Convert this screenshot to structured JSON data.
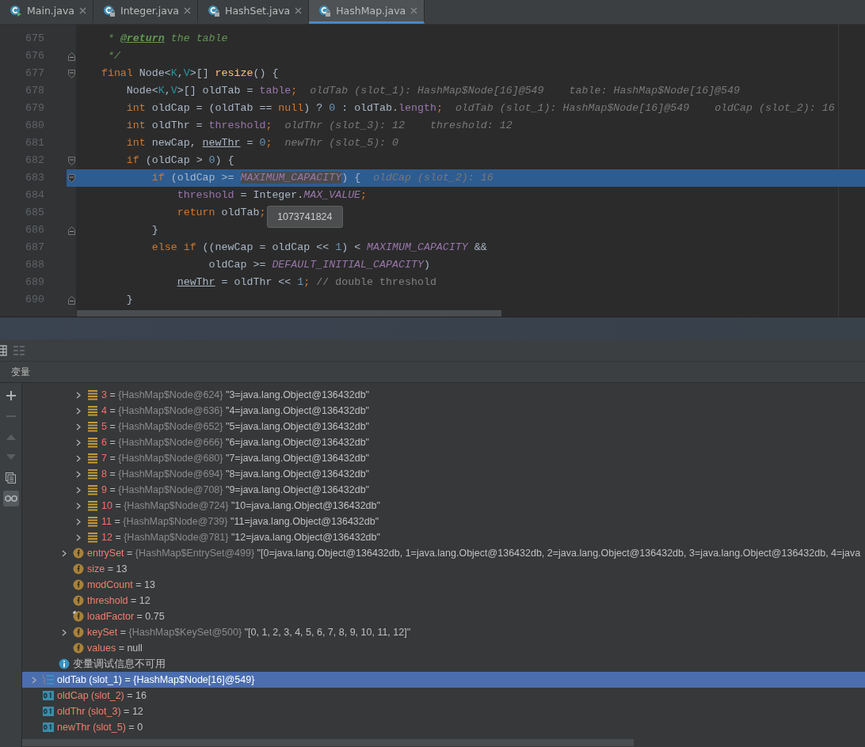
{
  "tabs": [
    {
      "label": "Main.java",
      "locked": false,
      "selected": false
    },
    {
      "label": "Integer.java",
      "locked": true,
      "selected": false
    },
    {
      "label": "HashSet.java",
      "locked": true,
      "selected": false
    },
    {
      "label": "HashMap.java",
      "locked": true,
      "selected": true
    }
  ],
  "editor": {
    "lines": [
      {
        "number": "675",
        "current": false,
        "tokens": [
          {
            "kind": "doc",
            "text": "     * "
          },
          {
            "kind": "doctag",
            "text": "@return"
          },
          {
            "kind": "doc",
            "text": " the table"
          }
        ]
      },
      {
        "number": "676",
        "fold_end": true,
        "current": false,
        "tokens": [
          {
            "kind": "doc",
            "text": "     */"
          }
        ]
      },
      {
        "number": "677",
        "fold_start": true,
        "current": false,
        "tokens": [
          {
            "kind": "kw",
            "text": "    final "
          },
          {
            "kind": "plain",
            "text": "Node<"
          },
          {
            "kind": "tp",
            "text": "K"
          },
          {
            "kind": "plain",
            "text": ","
          },
          {
            "kind": "tp",
            "text": "V"
          },
          {
            "kind": "plain",
            "text": ">[] "
          },
          {
            "kind": "fn",
            "text": "resize"
          },
          {
            "kind": "plain",
            "text": "() {"
          }
        ]
      },
      {
        "number": "678",
        "current": false,
        "tokens": [
          {
            "kind": "plain",
            "text": "        Node<"
          },
          {
            "kind": "tp",
            "text": "K"
          },
          {
            "kind": "plain",
            "text": ","
          },
          {
            "kind": "tp",
            "text": "V"
          },
          {
            "kind": "plain",
            "text": ">[] oldTab = "
          },
          {
            "kind": "field",
            "text": "table"
          },
          {
            "kind": "kw",
            "text": ";"
          }
        ],
        "hints": [
          "oldTab (slot_1): HashMap$Node[16]@549",
          "table: HashMap$Node[16]@549"
        ]
      },
      {
        "number": "679",
        "current": false,
        "tokens": [
          {
            "kind": "kw",
            "text": "        int "
          },
          {
            "kind": "plain",
            "text": "oldCap = (oldTab == "
          },
          {
            "kind": "kw",
            "text": "null"
          },
          {
            "kind": "plain",
            "text": ") ? "
          },
          {
            "kind": "num",
            "text": "0"
          },
          {
            "kind": "plain",
            "text": " : oldTab."
          },
          {
            "kind": "field",
            "text": "length"
          },
          {
            "kind": "kw",
            "text": ";"
          }
        ],
        "hints": [
          "oldTab (slot_1): HashMap$Node[16]@549",
          "oldCap (slot_2): 16"
        ]
      },
      {
        "number": "680",
        "current": false,
        "tokens": [
          {
            "kind": "kw",
            "text": "        int "
          },
          {
            "kind": "plain",
            "text": "oldThr = "
          },
          {
            "kind": "field",
            "text": "threshold"
          },
          {
            "kind": "kw",
            "text": ";"
          }
        ],
        "hints": [
          "oldThr (slot_3): 12",
          "threshold: 12"
        ]
      },
      {
        "number": "681",
        "current": false,
        "tokens": [
          {
            "kind": "kw",
            "text": "        int "
          },
          {
            "kind": "plain",
            "text": "newCap, "
          },
          {
            "kind": "underline",
            "text": "newThr"
          },
          {
            "kind": "plain",
            "text": " = "
          },
          {
            "kind": "num",
            "text": "0"
          },
          {
            "kind": "kw",
            "text": ";"
          }
        ],
        "hints": [
          "newThr (slot_5): 0"
        ]
      },
      {
        "number": "682",
        "fold_start": true,
        "current": false,
        "tokens": [
          {
            "kind": "kw",
            "text": "        if "
          },
          {
            "kind": "plain",
            "text": "(oldCap > "
          },
          {
            "kind": "num",
            "text": "0"
          },
          {
            "kind": "plain",
            "text": ") {"
          }
        ]
      },
      {
        "number": "683",
        "fold_start": true,
        "current": true,
        "tokens": [
          {
            "kind": "kw",
            "text": "            if "
          },
          {
            "kind": "plain",
            "text": "(oldCap >= "
          },
          {
            "kind": "hovered",
            "text": "MAXIMUM_CAPACITY"
          },
          {
            "kind": "plain",
            "text": ") {"
          }
        ],
        "hints": [
          "oldCap (slot_2): 16"
        ]
      },
      {
        "number": "684",
        "current": false,
        "tokens": [
          {
            "kind": "field",
            "text": "                threshold"
          },
          {
            "kind": "plain",
            "text": " = Integer."
          },
          {
            "kind": "const",
            "text": "MAX_VALUE"
          },
          {
            "kind": "kw",
            "text": ";"
          }
        ]
      },
      {
        "number": "685",
        "current": false,
        "tokens": [
          {
            "kind": "kw",
            "text": "                return "
          },
          {
            "kind": "plain",
            "text": "oldTab"
          },
          {
            "kind": "kw",
            "text": ";"
          }
        ]
      },
      {
        "number": "686",
        "fold_end": true,
        "current": false,
        "tokens": [
          {
            "kind": "plain",
            "text": "            }"
          }
        ]
      },
      {
        "number": "687",
        "current": false,
        "tokens": [
          {
            "kind": "kw",
            "text": "            else if "
          },
          {
            "kind": "plain",
            "text": "((newCap = oldCap << "
          },
          {
            "kind": "num",
            "text": "1"
          },
          {
            "kind": "plain",
            "text": ") < "
          },
          {
            "kind": "const",
            "text": "MAXIMUM_CAPACITY"
          },
          {
            "kind": "plain",
            "text": " &&"
          }
        ]
      },
      {
        "number": "688",
        "current": false,
        "tokens": [
          {
            "kind": "plain",
            "text": "                     oldCap >= "
          },
          {
            "kind": "const",
            "text": "DEFAULT_INITIAL_CAPACITY"
          },
          {
            "kind": "plain",
            "text": ")"
          }
        ]
      },
      {
        "number": "689",
        "current": false,
        "tokens": [
          {
            "kind": "underline",
            "text": "                newThr"
          },
          {
            "kind": "plain",
            "text": " = oldThr << "
          },
          {
            "kind": "num",
            "text": "1"
          },
          {
            "kind": "kw",
            "text": "; "
          },
          {
            "kind": "comment",
            "text": "// double threshold"
          }
        ]
      },
      {
        "number": "690",
        "fold_end": true,
        "current": false,
        "tokens": [
          {
            "kind": "plain",
            "text": "        }"
          }
        ]
      }
    ],
    "tooltip": "1073741824"
  },
  "panel": {
    "title": "变量",
    "side_toolbar": [
      {
        "kind": "add",
        "disabled": false,
        "on": false
      },
      {
        "kind": "remove",
        "disabled": true,
        "on": false
      },
      {
        "kind": "up",
        "disabled": true,
        "on": false
      },
      {
        "kind": "down",
        "disabled": true,
        "on": false
      },
      {
        "kind": "copy",
        "disabled": false,
        "on": false
      },
      {
        "kind": "watch",
        "disabled": false,
        "on": true
      }
    ],
    "variables": [
      {
        "kind": "entry",
        "expandable": true,
        "selected": false,
        "name": "3",
        "op": "=",
        "ref": "{HashMap$Node@624}",
        "value": "\"3=java.lang.Object@136432db\""
      },
      {
        "kind": "entry",
        "expandable": true,
        "selected": false,
        "name": "4",
        "op": "=",
        "ref": "{HashMap$Node@636}",
        "value": "\"4=java.lang.Object@136432db\""
      },
      {
        "kind": "entry",
        "expandable": true,
        "selected": false,
        "name": "5",
        "op": "=",
        "ref": "{HashMap$Node@652}",
        "value": "\"5=java.lang.Object@136432db\""
      },
      {
        "kind": "entry",
        "expandable": true,
        "selected": false,
        "name": "6",
        "op": "=",
        "ref": "{HashMap$Node@666}",
        "value": "\"6=java.lang.Object@136432db\""
      },
      {
        "kind": "entry",
        "expandable": true,
        "selected": false,
        "name": "7",
        "op": "=",
        "ref": "{HashMap$Node@680}",
        "value": "\"7=java.lang.Object@136432db\""
      },
      {
        "kind": "entry",
        "expandable": true,
        "selected": false,
        "name": "8",
        "op": "=",
        "ref": "{HashMap$Node@694}",
        "value": "\"8=java.lang.Object@136432db\""
      },
      {
        "kind": "entry",
        "expandable": true,
        "selected": false,
        "name": "9",
        "op": "=",
        "ref": "{HashMap$Node@708}",
        "value": "\"9=java.lang.Object@136432db\""
      },
      {
        "kind": "entry",
        "expandable": true,
        "selected": false,
        "name": "10",
        "op": "=",
        "ref": "{HashMap$Node@724}",
        "value": "\"10=java.lang.Object@136432db\""
      },
      {
        "kind": "entry",
        "expandable": true,
        "selected": false,
        "name": "11",
        "op": "=",
        "ref": "{HashMap$Node@739}",
        "value": "\"11=java.lang.Object@136432db\""
      },
      {
        "kind": "entry",
        "expandable": true,
        "selected": false,
        "name": "12",
        "op": "=",
        "ref": "{HashMap$Node@781}",
        "value": "\"12=java.lang.Object@136432db\""
      },
      {
        "kind": "field",
        "expandable": true,
        "selected": false,
        "name": "entrySet",
        "op": "=",
        "ref": "{HashMap$EntrySet@499}",
        "value": "\"[0=java.lang.Object@136432db, 1=java.lang.Object@136432db, 2=java.lang.Object@136432db, 3=java.lang.Object@136432db, 4=java"
      },
      {
        "kind": "field",
        "expandable": false,
        "selected": false,
        "name": "size",
        "op": "=",
        "value": "13"
      },
      {
        "kind": "field",
        "expandable": false,
        "selected": false,
        "name": "modCount",
        "op": "=",
        "value": "13"
      },
      {
        "kind": "field",
        "expandable": false,
        "selected": false,
        "name": "threshold",
        "op": "=",
        "value": "12"
      },
      {
        "kind": "final-field",
        "expandable": false,
        "selected": false,
        "name": "loadFactor",
        "op": "=",
        "value": "0.75"
      },
      {
        "kind": "field",
        "expandable": true,
        "selected": false,
        "name": "keySet",
        "op": "=",
        "ref": "{HashMap$KeySet@500}",
        "value": "\"[0, 1, 2, 3, 4, 5, 6, 7, 8, 9, 10, 11, 12]\""
      },
      {
        "kind": "field",
        "expandable": false,
        "selected": false,
        "name": "values",
        "op": "=",
        "value": "null"
      },
      {
        "kind": "info",
        "expandable": false,
        "selected": false,
        "name": "变量调试信息不可用"
      },
      {
        "kind": "array-local",
        "expandable": true,
        "selected": true,
        "name": "oldTab (slot_1)",
        "op": "=",
        "value": "{HashMap$Node[16]@549}"
      },
      {
        "kind": "int-local",
        "expandable": false,
        "selected": false,
        "name": "oldCap (slot_2)",
        "op": "=",
        "value": "16"
      },
      {
        "kind": "int-local",
        "expandable": false,
        "selected": false,
        "name": "oldThr (slot_3)",
        "op": "=",
        "value": "12"
      },
      {
        "kind": "int-local",
        "expandable": false,
        "selected": false,
        "name": "newThr (slot_5)",
        "op": "=",
        "value": "0"
      }
    ]
  }
}
